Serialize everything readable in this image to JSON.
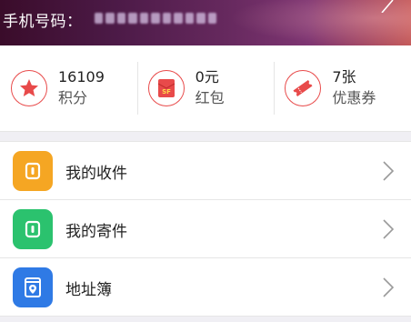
{
  "header": {
    "phone_label": "手机号码：",
    "phone_value_masked": "•••••••••••"
  },
  "stats": [
    {
      "value": "16109",
      "label": "积分",
      "icon": "star-icon"
    },
    {
      "value": "0元",
      "label": "红包",
      "icon": "sf-red-envelope-icon",
      "icon_text": "SF"
    },
    {
      "value": "7张",
      "label": "优惠券",
      "icon": "coupon-ticket-icon"
    }
  ],
  "menu": [
    {
      "label": "我的收件",
      "icon": "receive-package-icon",
      "color": "#f5a623"
    },
    {
      "label": "我的寄件",
      "icon": "send-package-icon",
      "color": "#2bc26e"
    },
    {
      "label": "地址簿",
      "icon": "address-book-icon",
      "color": "#2f7ae5"
    }
  ],
  "colors": {
    "accent_red": "#e84a4a",
    "header_gradient_start": "#3a0c2a",
    "header_gradient_end": "#c45a5a"
  }
}
